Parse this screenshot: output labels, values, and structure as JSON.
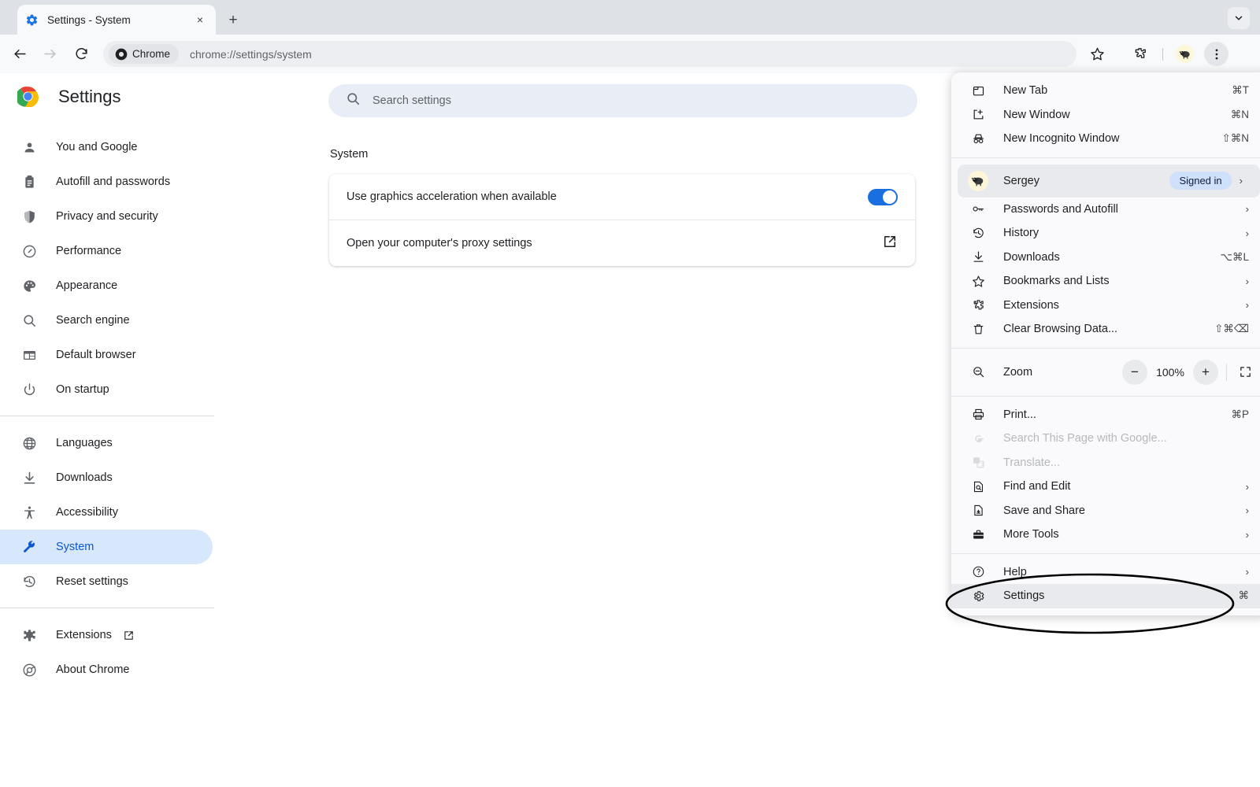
{
  "browser": {
    "tab": {
      "title": "Settings - System",
      "favicon": "settings-gear-favicon",
      "close": "×"
    },
    "new_tab_button": "+",
    "tab_search": "chevron-down-icon",
    "toolbar": {
      "back": "back-arrow-icon",
      "forward": "forward-arrow-icon",
      "reload": "reload-icon",
      "chrome_pill": "Chrome",
      "url": "chrome://settings/system",
      "bookmark": "star-icon",
      "extensions": "puzzle-icon",
      "avatar": "sheep-avatar",
      "menu": "three-dot-menu-icon"
    }
  },
  "settings": {
    "title": "Settings",
    "search": {
      "placeholder": "Search settings",
      "value": ""
    },
    "section_title": "System",
    "sidebar": [
      {
        "label": "You and Google",
        "icon": "person-icon",
        "selected": false
      },
      {
        "label": "Autofill and passwords",
        "icon": "clipboard-icon",
        "selected": false
      },
      {
        "label": "Privacy and security",
        "icon": "shield-icon",
        "selected": false
      },
      {
        "label": "Performance",
        "icon": "gauge-icon",
        "selected": false
      },
      {
        "label": "Appearance",
        "icon": "palette-icon",
        "selected": false
      },
      {
        "label": "Search engine",
        "icon": "search-icon",
        "selected": false
      },
      {
        "label": "Default browser",
        "icon": "window-icon",
        "selected": false
      },
      {
        "label": "On startup",
        "icon": "power-icon",
        "selected": false
      },
      {
        "label": "Languages",
        "icon": "globe-icon",
        "selected": false
      },
      {
        "label": "Downloads",
        "icon": "download-icon",
        "selected": false
      },
      {
        "label": "Accessibility",
        "icon": "accessibility-icon",
        "selected": false
      },
      {
        "label": "System",
        "icon": "wrench-icon",
        "selected": true
      },
      {
        "label": "Reset settings",
        "icon": "history-restore-icon",
        "selected": false
      },
      {
        "label": "Extensions",
        "icon": "puzzle-icon",
        "selected": false,
        "external": true
      },
      {
        "label": "About Chrome",
        "icon": "chrome-logo-icon",
        "selected": false
      }
    ],
    "rows": [
      {
        "label": "Use graphics acceleration when available",
        "control": "toggle",
        "toggle_on": true
      },
      {
        "label": "Open your computer's proxy settings",
        "control": "external-link"
      }
    ],
    "accent_color": "#0b57d0",
    "toggle_on_color": "#1a6fe0",
    "selected_bg": "#d7e7fc"
  },
  "menu": {
    "group1": [
      {
        "label": "New Tab",
        "icon": "new-tab-icon",
        "accel": "⌘T"
      },
      {
        "label": "New Window",
        "icon": "new-window-icon",
        "accel": "⌘N"
      },
      {
        "label": "New Incognito Window",
        "icon": "incognito-icon",
        "accel": "⇧⌘N"
      }
    ],
    "profile": {
      "label": "Sergey",
      "badge": "Signed in",
      "avatar": "sheep-avatar",
      "arrow": "›"
    },
    "group2": [
      {
        "label": "Passwords and Autofill",
        "icon": "key-icon",
        "arrow": "›"
      },
      {
        "label": "History",
        "icon": "history-icon",
        "arrow": "›"
      },
      {
        "label": "Downloads",
        "icon": "download-icon",
        "accel": "⌥⌘L"
      },
      {
        "label": "Bookmarks and Lists",
        "icon": "star-icon",
        "arrow": "›"
      },
      {
        "label": "Extensions",
        "icon": "puzzle-icon",
        "arrow": "›"
      },
      {
        "label": "Clear Browsing Data...",
        "icon": "trash-icon",
        "accel": "⇧⌘⌫"
      }
    ],
    "zoom": {
      "label": "Zoom",
      "icon": "zoom-icon",
      "minus": "−",
      "value": "100%",
      "plus": "+",
      "fullscreen": "fullscreen-icon"
    },
    "group3": [
      {
        "label": "Print...",
        "icon": "printer-icon",
        "accel": "⌘P",
        "disabled": false
      },
      {
        "label": "Search This Page with Google...",
        "icon": "google-g-icon",
        "disabled": true
      },
      {
        "label": "Translate...",
        "icon": "translate-icon",
        "disabled": true
      },
      {
        "label": "Find and Edit",
        "icon": "find-icon",
        "arrow": "›",
        "disabled": false
      },
      {
        "label": "Save and Share",
        "icon": "save-share-icon",
        "arrow": "›",
        "disabled": false
      },
      {
        "label": "More Tools",
        "icon": "toolbox-icon",
        "arrow": "›",
        "disabled": false
      }
    ],
    "group4": [
      {
        "label": "Help",
        "icon": "help-circle-icon",
        "arrow": "›",
        "highlight": false
      },
      {
        "label": "Settings",
        "icon": "gear-icon",
        "accel": "⌘",
        "highlight": true
      }
    ]
  },
  "annotation": {
    "shape": "ellipse",
    "target": "Settings",
    "color": "#000000"
  }
}
